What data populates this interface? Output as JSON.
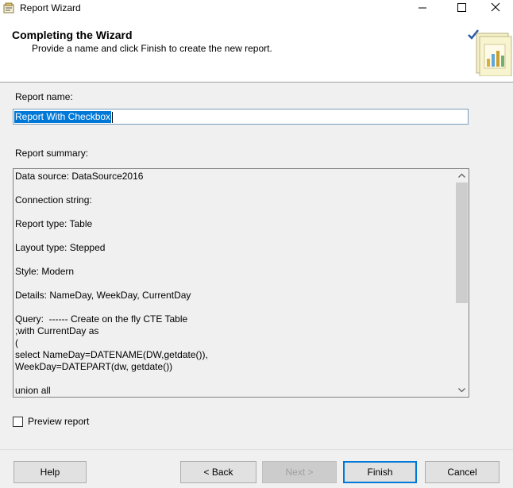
{
  "window": {
    "title": "Report Wizard",
    "icon": "wizard-app-icon"
  },
  "header": {
    "title": "Completing the Wizard",
    "subtitle": "Provide a name and click Finish to create the new report.",
    "graphic": "report-wizard-graphic-icon"
  },
  "form": {
    "report_name_label": "Report name:",
    "report_name_value": "Report With Checkbox",
    "summary_label": "Report summary:",
    "summary_text": "Data source: DataSource2016\n\nConnection string:\n\nReport type: Table\n\nLayout type: Stepped\n\nStyle: Modern\n\nDetails: NameDay, WeekDay, CurrentDay\n\nQuery:  ------ Create on the fly CTE Table\n;with CurrentDay as\n(\nselect NameDay=DATENAME(DW,getdate()),\nWeekDay=DATEPART(dw, getdate())\n\nunion all",
    "preview_label": "Preview report",
    "preview_checked": false
  },
  "buttons": {
    "help": "Help",
    "back": "< Back",
    "next": "Next >",
    "finish": "Finish",
    "cancel": "Cancel"
  },
  "colors": {
    "selection": "#0078d7",
    "focus_border": "#7a9cb8"
  }
}
